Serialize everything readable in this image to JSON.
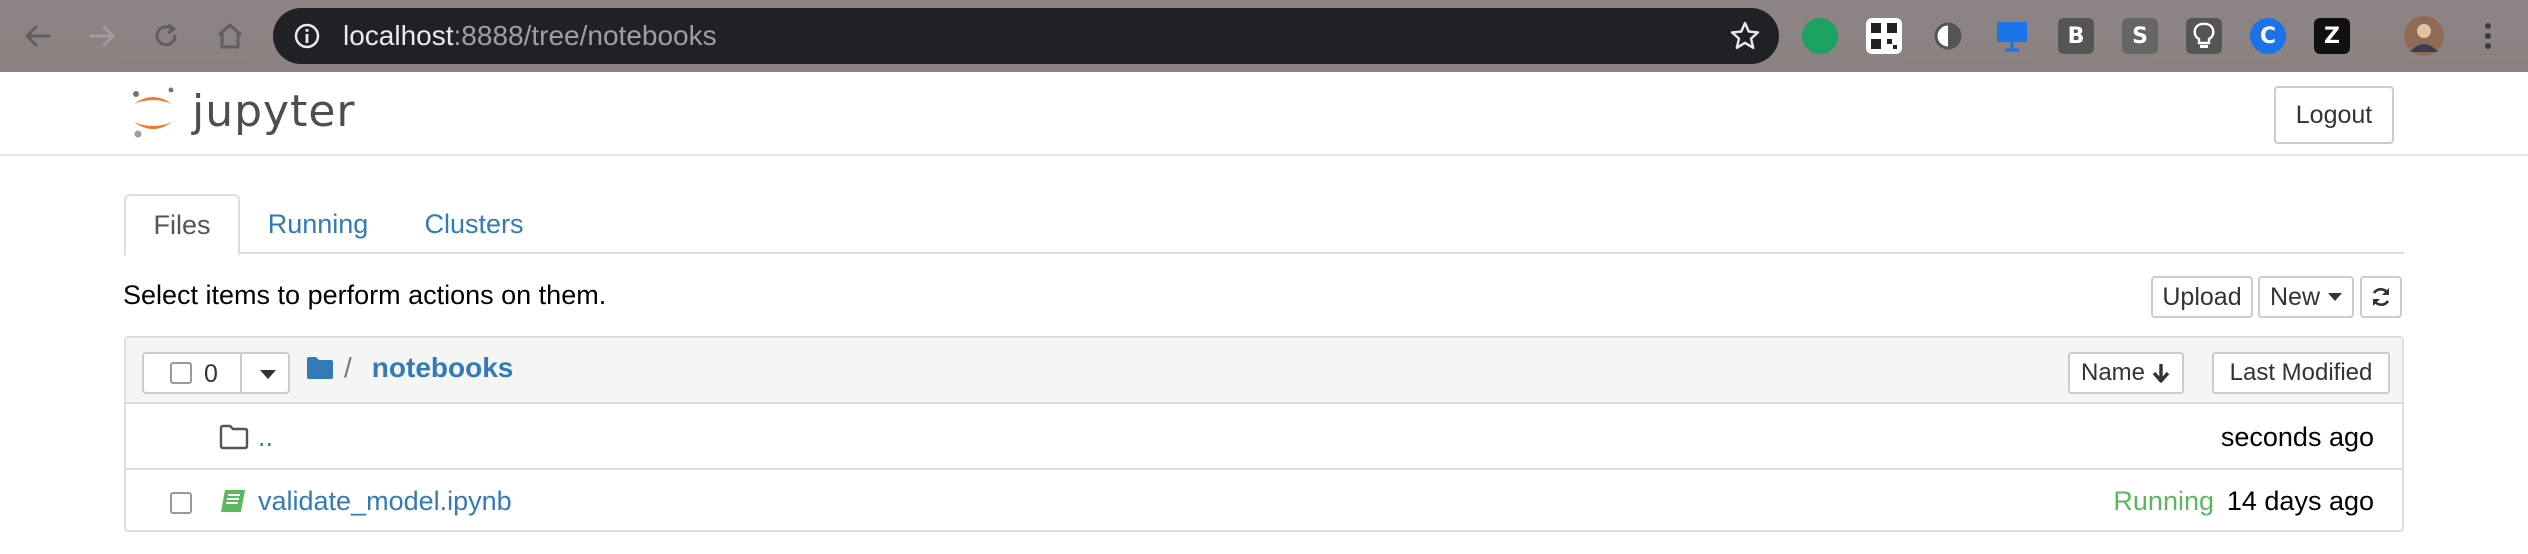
{
  "browser": {
    "url_host": "localhost",
    "url_rest": ":8888/tree/notebooks",
    "extensions": [
      {
        "name": "green-dot",
        "color": "#1aa260",
        "glyph": ""
      },
      {
        "name": "qr-code",
        "color": "#444444",
        "glyph": ""
      },
      {
        "name": "circle",
        "color": "#555555",
        "glyph": ""
      },
      {
        "name": "screen",
        "color": "#1a73e8",
        "glyph": ""
      },
      {
        "name": "b-ext",
        "color": "#555555",
        "glyph": "B"
      },
      {
        "name": "s-ext",
        "color": "#666666",
        "glyph": "S"
      },
      {
        "name": "bulb",
        "color": "#555555",
        "glyph": ""
      },
      {
        "name": "c-ext",
        "color": "#1a73e8",
        "glyph": "C"
      },
      {
        "name": "z-ext",
        "color": "#111111",
        "glyph": "Z"
      }
    ]
  },
  "header": {
    "logo_text": "jupyter",
    "logout_label": "Logout"
  },
  "tabs": [
    {
      "label": "Files"
    },
    {
      "label": "Running"
    },
    {
      "label": "Clusters"
    }
  ],
  "hint": "Select items to perform actions on them.",
  "toolbar": {
    "upload_label": "Upload",
    "new_label": "New"
  },
  "list": {
    "selected_count": "0",
    "path_sep": "/",
    "folder": "notebooks",
    "sort_name_label": "Name",
    "sort_modified_label": "Last Modified",
    "items": [
      {
        "name": "..",
        "modified": "seconds ago",
        "status": ""
      },
      {
        "name": "validate_model.ipynb",
        "modified": "14 days ago",
        "status": "Running"
      }
    ]
  },
  "colors": {
    "link": "#337ab7",
    "running": "#5cb85c",
    "notebook_icon": "#5cb85c",
    "logo_orange": "#f37726"
  }
}
